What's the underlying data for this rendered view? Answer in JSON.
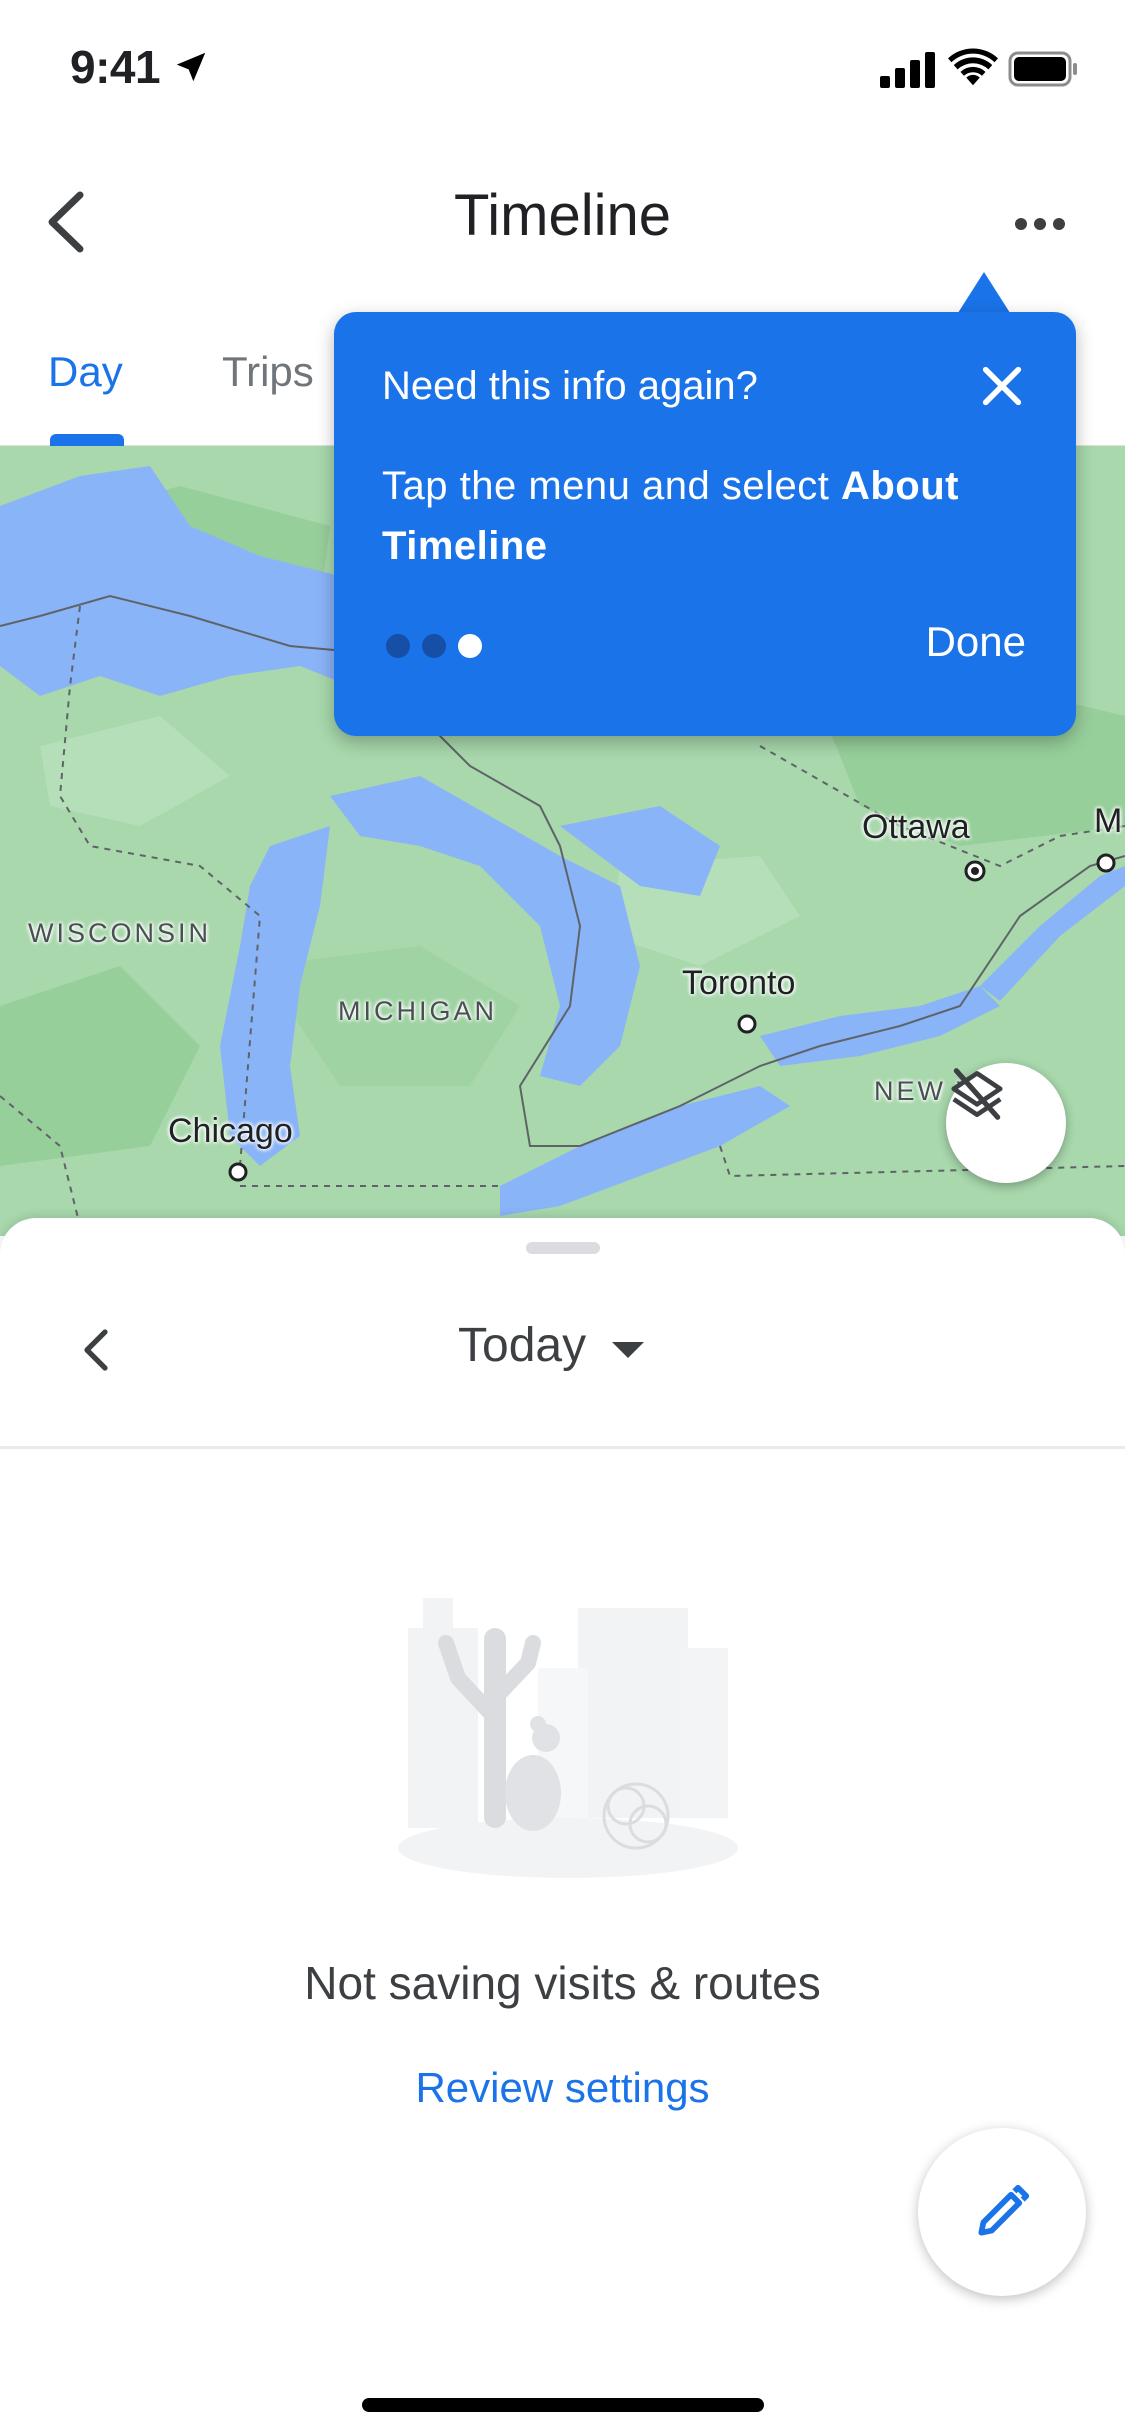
{
  "status_bar": {
    "time": "9:41",
    "icons": [
      "location-arrow-icon",
      "cellular-signal-icon",
      "wifi-icon",
      "battery-icon"
    ]
  },
  "header": {
    "title": "Timeline",
    "back_icon": "chevron-left-icon",
    "menu_icon": "more-horizontal-icon"
  },
  "tabs": [
    {
      "label": "Day",
      "active": true
    },
    {
      "label": "Trips",
      "active": false
    }
  ],
  "map": {
    "labels": {
      "ottawa": "Ottawa",
      "toronto": "Toronto",
      "chicago": "Chicago",
      "wisconsin": "WISCONSIN",
      "michigan": "MICHIGAN",
      "new_york": "NEW Y",
      "edge_m": "M"
    },
    "layers_icon": "layers-off-icon",
    "colors": {
      "land": "#a8d8ac",
      "water": "#8ab4f8",
      "border": "#5f6368"
    }
  },
  "tooltip": {
    "title": "Need this info again?",
    "body_prefix": "Tap the menu and select ",
    "body_bold": "About Timeline",
    "done_label": "Done",
    "close_icon": "close-icon",
    "pager_count": 3,
    "pager_current": 3,
    "color": "#1a73e8"
  },
  "sheet": {
    "date_label": "Today",
    "prev_icon": "chevron-left-icon",
    "dropdown_icon": "caret-down-icon",
    "illustration": "desert-cactus-illustration",
    "empty_title": "Not saving visits & routes",
    "review_link": "Review settings",
    "fab_icon": "pencil-icon"
  }
}
